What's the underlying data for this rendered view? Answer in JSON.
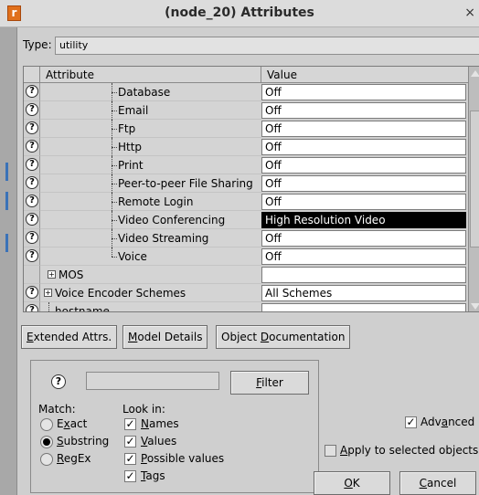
{
  "window": {
    "title": "(node_20) Attributes",
    "close_glyph": "×",
    "app_icon_letter": "r"
  },
  "type_row": {
    "label": "Type:",
    "value": "utility"
  },
  "table": {
    "headers": {
      "attribute": "Attribute",
      "value": "Value"
    },
    "rows": [
      {
        "attribute": "Database",
        "value": "Off"
      },
      {
        "attribute": "Email",
        "value": "Off"
      },
      {
        "attribute": "Ftp",
        "value": "Off"
      },
      {
        "attribute": "Http",
        "value": "Off"
      },
      {
        "attribute": "Print",
        "value": "Off"
      },
      {
        "attribute": "Peer-to-peer File Sharing",
        "value": "Off"
      },
      {
        "attribute": "Remote Login",
        "value": "Off"
      },
      {
        "attribute": "Video Conferencing",
        "value": "High Resolution Video",
        "selected": true
      },
      {
        "attribute": "Video Streaming",
        "value": "Off"
      },
      {
        "attribute": "Voice",
        "value": "Off"
      },
      {
        "attribute": "MOS",
        "value": ""
      },
      {
        "attribute": "Voice Encoder Schemes",
        "value": "All Schemes"
      },
      {
        "attribute": "hostname",
        "value": ""
      }
    ]
  },
  "buttons": {
    "extended_attrs": {
      "pre": "",
      "mnemonic": "E",
      "post": "xtended Attrs."
    },
    "model_details": {
      "pre": "",
      "mnemonic": "M",
      "post": "odel Details"
    },
    "object_documentation": {
      "pre": "Object ",
      "mnemonic": "D",
      "post": "ocumentation"
    },
    "filter": {
      "pre": "",
      "mnemonic": "F",
      "post": "ilter"
    },
    "ok": {
      "pre": "",
      "mnemonic": "O",
      "post": "K"
    },
    "cancel": {
      "pre": "",
      "mnemonic": "C",
      "post": "ancel"
    }
  },
  "find_panel": {
    "query": "",
    "match_label": "Match:",
    "match_options": [
      {
        "pre": "E",
        "mnemonic": "x",
        "post": "act",
        "selected": false
      },
      {
        "pre": "",
        "mnemonic": "S",
        "post": "ubstring",
        "selected": true
      },
      {
        "pre": "",
        "mnemonic": "R",
        "post": "egEx",
        "selected": false
      }
    ],
    "look_in_label": "Look in:",
    "look_in_options": [
      {
        "pre": "",
        "mnemonic": "N",
        "post": "ames",
        "checked": true
      },
      {
        "pre": "",
        "mnemonic": "V",
        "post": "alues",
        "checked": true
      },
      {
        "pre": "",
        "mnemonic": "P",
        "post": "ossible values",
        "checked": true
      },
      {
        "pre": "",
        "mnemonic": "T",
        "post": "ags",
        "checked": true
      }
    ]
  },
  "options": {
    "advanced": {
      "pre": "Adv",
      "mnemonic": "a",
      "post": "nced",
      "checked": true
    },
    "apply_to_selected": {
      "pre": "",
      "mnemonic": "A",
      "post": "pply to selected objects",
      "checked": false
    }
  },
  "colors": {
    "selection_bg": "#000000",
    "app_icon": "#e0701c"
  },
  "icons": {
    "row_info": "question-circle-icon",
    "expander": "plus-box-icon"
  }
}
